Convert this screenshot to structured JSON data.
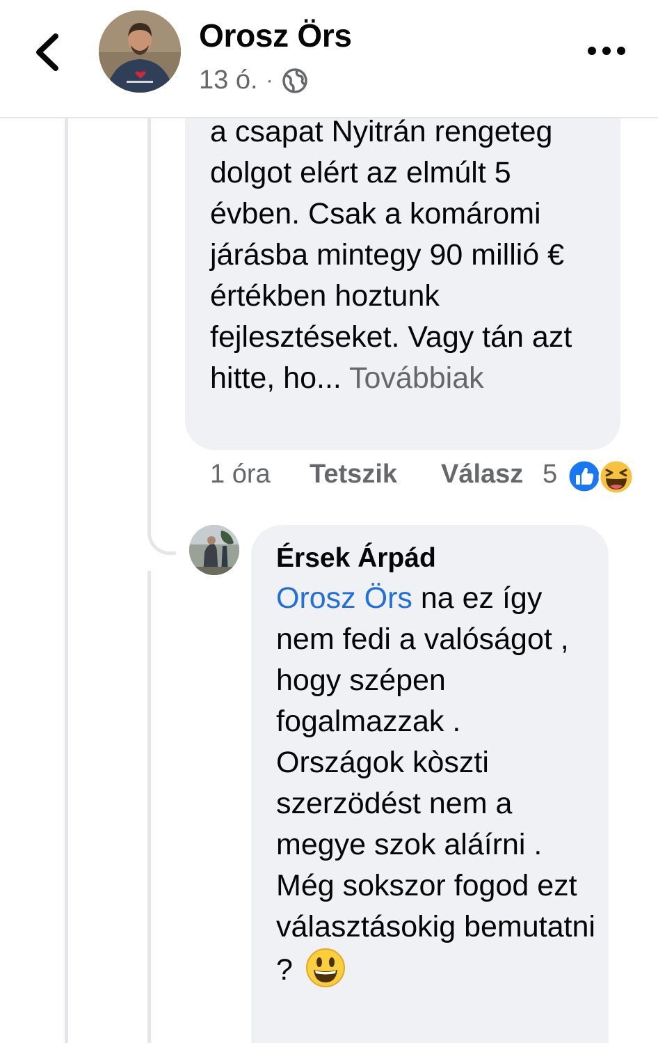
{
  "header": {
    "back_icon": "chevron-left-icon",
    "poster_name": "Orosz Örs",
    "time": "13 ó.",
    "separator": "·",
    "privacy_icon": "globe-icon",
    "more_icon": "more-horizontal-icon"
  },
  "comment1": {
    "text": "a csapat Nyitrán rengeteg dolgot elért az elmúlt 5 évben. Csak a komáromi járásba mintegy 90 millió € értékben hoztunk fejlesztéseket. Vagy tán azt hitte, ho...",
    "see_more": "Továbbiak",
    "time": "1 óra",
    "like_label": "Tetszik",
    "reply_label": "Válasz",
    "reaction_count": "5",
    "reactions": [
      "like-reaction-icon",
      "haha-reaction-icon"
    ]
  },
  "comment2": {
    "author": "Érsek Árpád",
    "mention": "Orosz Örs",
    "text": " na ez így nem fedi a valóságot , hogy szépen fogalmazzak . Országok kòszti szerzödést nem a megye szok aláírni . Még sokszor fogod ezt választásokig bemutatni ?",
    "emoji": "smiley-emoji-icon"
  },
  "colors": {
    "bubble": "#eff1f4",
    "secondary_text": "#65676b",
    "mention": "#216fdb",
    "like_blue": "#1877f2",
    "haha_yellow": "#f7c33e"
  }
}
